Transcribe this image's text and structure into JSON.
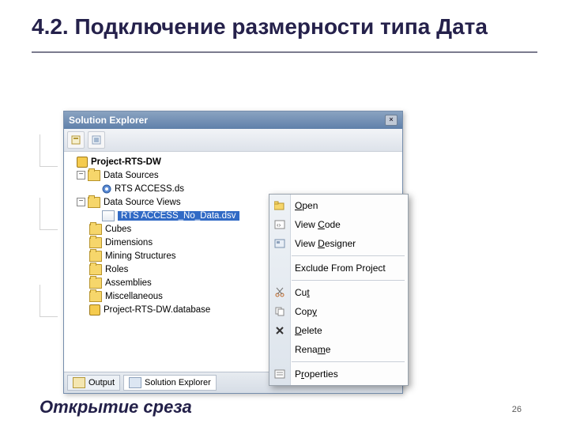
{
  "slide": {
    "title": "4.2. Подключение размерности типа Дата",
    "caption": "Открытие среза",
    "page": "26"
  },
  "panel": {
    "title": "Solution Explorer"
  },
  "tree": {
    "project": "Project-RTS-DW",
    "nodes": {
      "data_sources": "Data Sources",
      "ds_item": "RTS ACCESS.ds",
      "dsv": "Data Source Views",
      "dsv_item": "RTS ACCESS_No_Data.dsv",
      "cubes": "Cubes",
      "dimensions": "Dimensions",
      "mining": "Mining Structures",
      "roles": "Roles",
      "assemblies": "Assemblies",
      "misc": "Miscellaneous",
      "dbfile": "Project-RTS-DW.database"
    }
  },
  "tabs": {
    "output": "Output",
    "solution": "Solution Explorer"
  },
  "context_menu": {
    "open": "Open",
    "view_code": "View Code",
    "view_designer": "View Designer",
    "exclude": "Exclude From Project",
    "cut": "Cut",
    "copy": "Copy",
    "delete": "Delete",
    "rename": "Rename",
    "properties": "Properties"
  }
}
